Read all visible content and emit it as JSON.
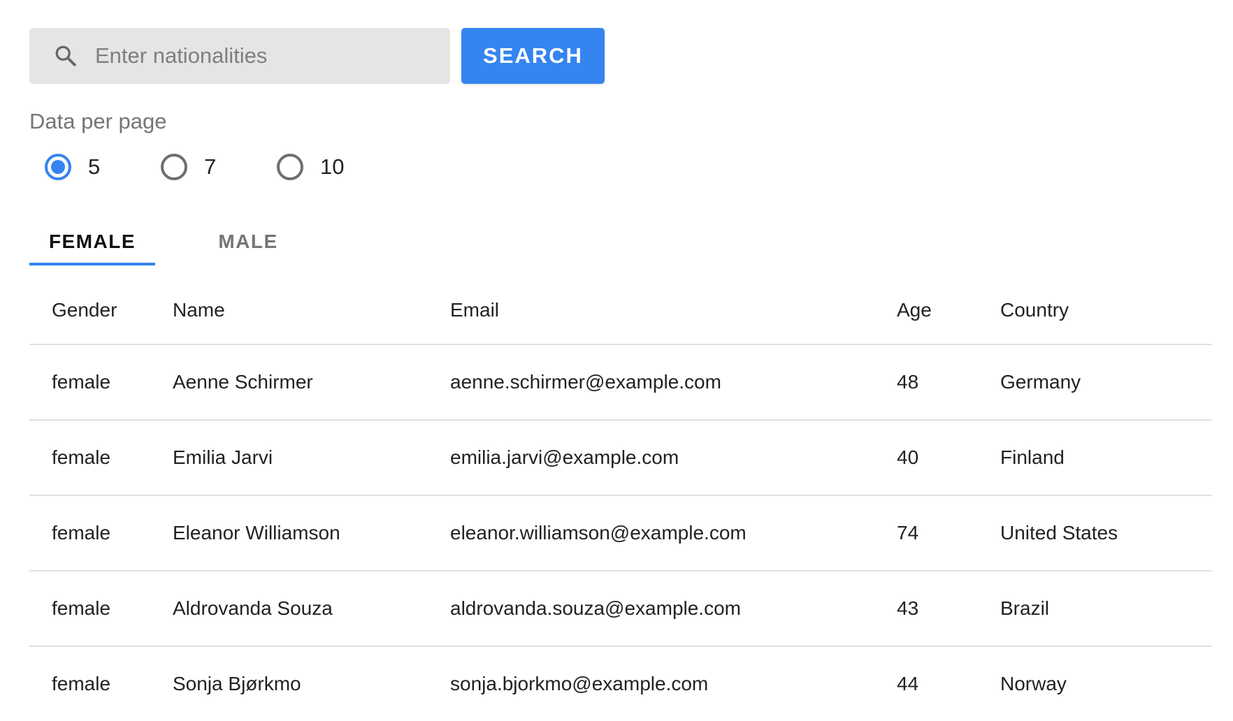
{
  "search": {
    "placeholder": "Enter nationalities",
    "value": "",
    "button_label": "SEARCH",
    "icon": "search-icon"
  },
  "per_page": {
    "label": "Data per page",
    "options": [
      {
        "label": "5",
        "selected": true
      },
      {
        "label": "7",
        "selected": false
      },
      {
        "label": "10",
        "selected": false
      }
    ]
  },
  "tabs": [
    {
      "label": "FEMALE",
      "active": true
    },
    {
      "label": "MALE",
      "active": false
    }
  ],
  "table": {
    "headers": [
      "Gender",
      "Name",
      "Email",
      "Age",
      "Country"
    ],
    "rows": [
      [
        "female",
        "Aenne Schirmer",
        "aenne.schirmer@example.com",
        "48",
        "Germany"
      ],
      [
        "female",
        "Emilia Jarvi",
        "emilia.jarvi@example.com",
        "40",
        "Finland"
      ],
      [
        "female",
        "Eleanor Williamson",
        "eleanor.williamson@example.com",
        "74",
        "United States"
      ],
      [
        "female",
        "Aldrovanda Souza",
        "aldrovanda.souza@example.com",
        "43",
        "Brazil"
      ],
      [
        "female",
        "Sonja Bjørkmo",
        "sonja.bjorkmo@example.com",
        "44",
        "Norway"
      ]
    ]
  },
  "colors": {
    "accent": "#3584f0",
    "search_bg": "#e5e5e5",
    "divider": "#e0e0e0"
  }
}
